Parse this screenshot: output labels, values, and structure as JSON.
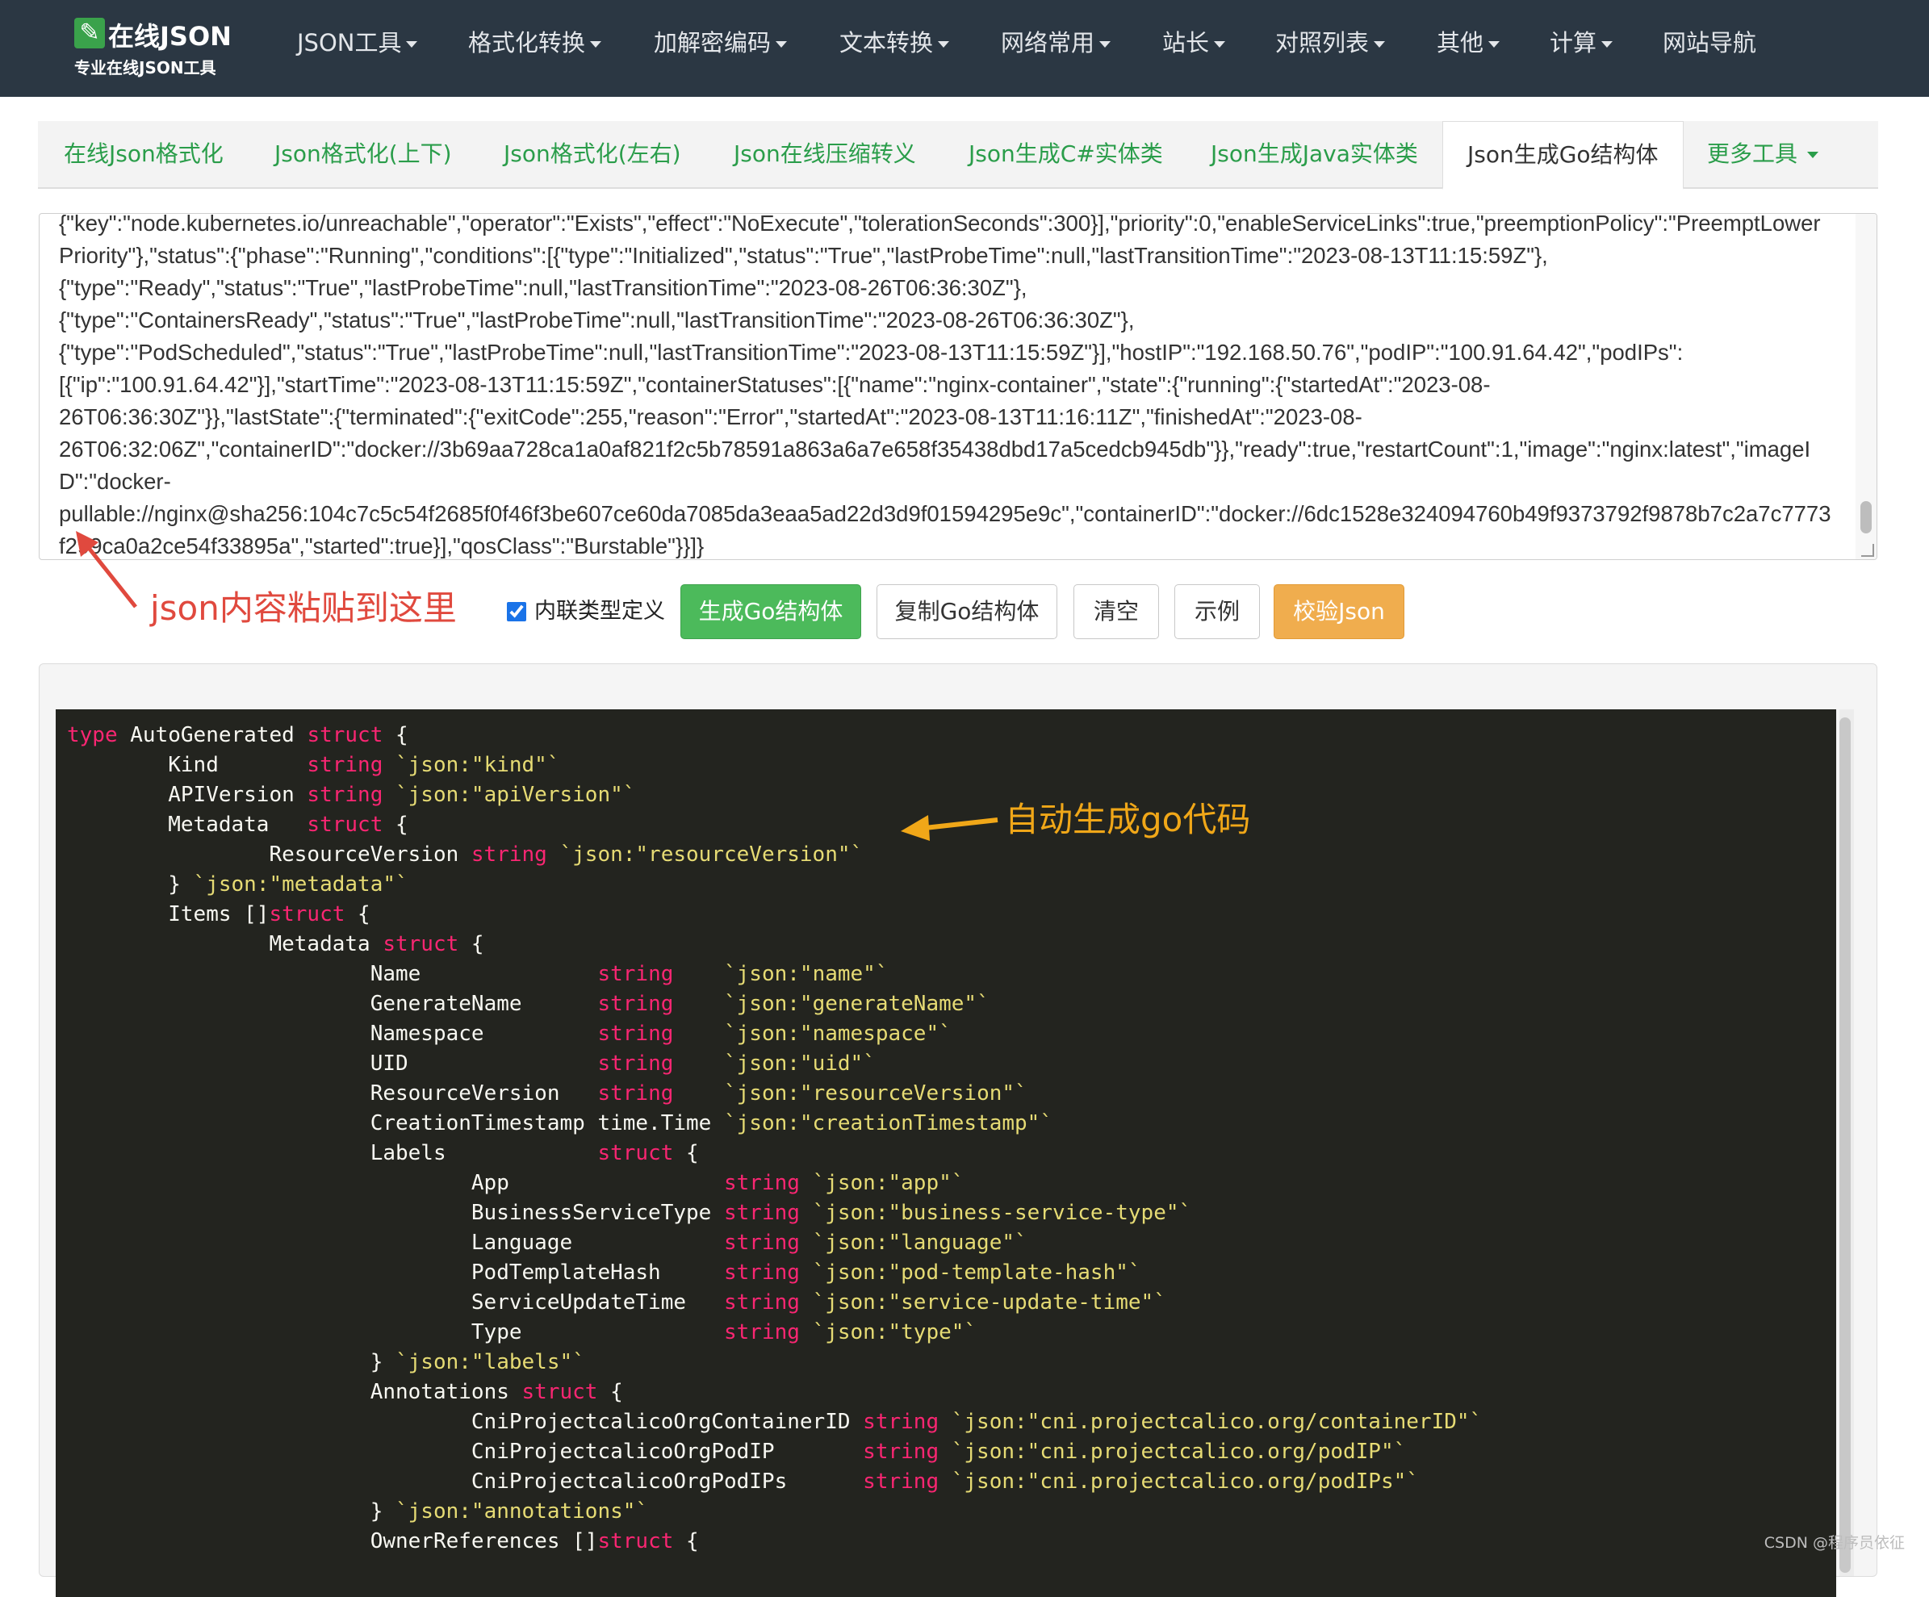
{
  "brand": {
    "title": "在线JSON",
    "subtitle": "专业在线JSON工具",
    "icon": "wrench-icon"
  },
  "nav": [
    {
      "label": "JSON工具",
      "dropdown": true
    },
    {
      "label": "格式化转换",
      "dropdown": true
    },
    {
      "label": "加解密编码",
      "dropdown": true
    },
    {
      "label": "文本转换",
      "dropdown": true
    },
    {
      "label": "网络常用",
      "dropdown": true
    },
    {
      "label": "站长",
      "dropdown": true
    },
    {
      "label": "对照列表",
      "dropdown": true
    },
    {
      "label": "其他",
      "dropdown": true
    },
    {
      "label": "计算",
      "dropdown": true
    },
    {
      "label": "网站导航",
      "dropdown": false
    }
  ],
  "tabs": [
    {
      "label": "在线Json格式化"
    },
    {
      "label": "Json格式化(上下)"
    },
    {
      "label": "Json格式化(左右)"
    },
    {
      "label": "Json在线压缩转义"
    },
    {
      "label": "Json生成C#实体类"
    },
    {
      "label": "Json生成Java实体类"
    },
    {
      "label": "Json生成Go结构体",
      "active": true
    },
    {
      "label": "更多工具",
      "dropdown": true
    }
  ],
  "json_input": {
    "value": "{\"key\":\"node.kubernetes.io/unreachable\",\"operator\":\"Exists\",\"effect\":\"NoExecute\",\"tolerationSeconds\":300}],\"priority\":0,\"enableServiceLinks\":true,\"preemptionPolicy\":\"PreemptLowerPriority\"},\"status\":{\"phase\":\"Running\",\"conditions\":[{\"type\":\"Initialized\",\"status\":\"True\",\"lastProbeTime\":null,\"lastTransitionTime\":\"2023-08-13T11:15:59Z\"},\n{\"type\":\"Ready\",\"status\":\"True\",\"lastProbeTime\":null,\"lastTransitionTime\":\"2023-08-26T06:36:30Z\"},\n{\"type\":\"ContainersReady\",\"status\":\"True\",\"lastProbeTime\":null,\"lastTransitionTime\":\"2023-08-26T06:36:30Z\"},\n{\"type\":\"PodScheduled\",\"status\":\"True\",\"lastProbeTime\":null,\"lastTransitionTime\":\"2023-08-13T11:15:59Z\"}],\"hostIP\":\"192.168.50.76\",\"podIP\":\"100.91.64.42\",\"podIPs\":\n[{\"ip\":\"100.91.64.42\"}],\"startTime\":\"2023-08-13T11:15:59Z\",\"containerStatuses\":[{\"name\":\"nginx-container\",\"state\":{\"running\":{\"startedAt\":\"2023-08-\n26T06:36:30Z\"}},\"lastState\":{\"terminated\":{\"exitCode\":255,\"reason\":\"Error\",\"startedAt\":\"2023-08-13T11:16:11Z\",\"finishedAt\":\"2023-08-\n26T06:32:06Z\",\"containerID\":\"docker://3b69aa728ca1a0af821f2c5b78591a863a6a7e658f35438dbd17a5cedcb945db\"}},\"ready\":true,\"restartCount\":1,\"image\":\"nginx:latest\",\"imageID\":\"docker-\npullable://nginx@sha256:104c7c5c54f2685f0f46f3be607ce60da7085da3eaa5ad22d3d9f01594295e9c\",\"containerID\":\"docker://6dc1528e324094760b49f9373792f9878b7c2a7c7773f299ca0a2ce54f33895a\",\"started\":true}],\"qosClass\":\"Burstable\"}}]}"
  },
  "annotations": {
    "paste_hint": "json内容粘贴到这里",
    "output_hint": "自动生成go代码"
  },
  "controls": {
    "inline_label": "内联类型定义",
    "inline_checked": true,
    "generate": "生成Go结构体",
    "copy": "复制Go结构体",
    "clear": "清空",
    "example": "示例",
    "validate": "校验Json"
  },
  "colors": {
    "keyword": "#f92672",
    "tag": "#e6db74",
    "green_button": "#4cba5b",
    "orange_button": "#f0ad4e",
    "navbar": "#2b3743"
  },
  "output": {
    "lines": [
      [
        [
          "kw",
          "type"
        ],
        [
          "pl",
          " AutoGenerated "
        ],
        [
          "kw",
          "struct"
        ],
        [
          "pl",
          " {"
        ]
      ],
      [
        [
          "pl",
          "\tKind       "
        ],
        [
          "kw",
          "string"
        ],
        [
          "pl",
          " "
        ],
        [
          "tg",
          "`json:\"kind\"`"
        ]
      ],
      [
        [
          "pl",
          "\tAPIVersion "
        ],
        [
          "kw",
          "string"
        ],
        [
          "pl",
          " "
        ],
        [
          "tg",
          "`json:\"apiVersion\"`"
        ]
      ],
      [
        [
          "pl",
          "\tMetadata   "
        ],
        [
          "kw",
          "struct"
        ],
        [
          "pl",
          " {"
        ]
      ],
      [
        [
          "pl",
          "\t\tResourceVersion "
        ],
        [
          "kw",
          "string"
        ],
        [
          "pl",
          " "
        ],
        [
          "tg",
          "`json:\"resourceVersion\"`"
        ]
      ],
      [
        [
          "pl",
          "\t} "
        ],
        [
          "tg",
          "`json:\"metadata\"`"
        ]
      ],
      [
        [
          "pl",
          "\tItems []"
        ],
        [
          "kw",
          "struct"
        ],
        [
          "pl",
          " {"
        ]
      ],
      [
        [
          "pl",
          "\t\tMetadata "
        ],
        [
          "kw",
          "struct"
        ],
        [
          "pl",
          " {"
        ]
      ],
      [
        [
          "pl",
          "\t\t\tName              "
        ],
        [
          "kw",
          "string"
        ],
        [
          "pl",
          "    "
        ],
        [
          "tg",
          "`json:\"name\"`"
        ]
      ],
      [
        [
          "pl",
          "\t\t\tGenerateName      "
        ],
        [
          "kw",
          "string"
        ],
        [
          "pl",
          "    "
        ],
        [
          "tg",
          "`json:\"generateName\"`"
        ]
      ],
      [
        [
          "pl",
          "\t\t\tNamespace         "
        ],
        [
          "kw",
          "string"
        ],
        [
          "pl",
          "    "
        ],
        [
          "tg",
          "`json:\"namespace\"`"
        ]
      ],
      [
        [
          "pl",
          "\t\t\tUID               "
        ],
        [
          "kw",
          "string"
        ],
        [
          "pl",
          "    "
        ],
        [
          "tg",
          "`json:\"uid\"`"
        ]
      ],
      [
        [
          "pl",
          "\t\t\tResourceVersion   "
        ],
        [
          "kw",
          "string"
        ],
        [
          "pl",
          "    "
        ],
        [
          "tg",
          "`json:\"resourceVersion\"`"
        ]
      ],
      [
        [
          "pl",
          "\t\t\tCreationTimestamp time.Time "
        ],
        [
          "tg",
          "`json:\"creationTimestamp\"`"
        ]
      ],
      [
        [
          "pl",
          "\t\t\tLabels            "
        ],
        [
          "kw",
          "struct"
        ],
        [
          "pl",
          " {"
        ]
      ],
      [
        [
          "pl",
          "\t\t\t\tApp                 "
        ],
        [
          "kw",
          "string"
        ],
        [
          "pl",
          " "
        ],
        [
          "tg",
          "`json:\"app\"`"
        ]
      ],
      [
        [
          "pl",
          "\t\t\t\tBusinessServiceType "
        ],
        [
          "kw",
          "string"
        ],
        [
          "pl",
          " "
        ],
        [
          "tg",
          "`json:\"business-service-type\"`"
        ]
      ],
      [
        [
          "pl",
          "\t\t\t\tLanguage            "
        ],
        [
          "kw",
          "string"
        ],
        [
          "pl",
          " "
        ],
        [
          "tg",
          "`json:\"language\"`"
        ]
      ],
      [
        [
          "pl",
          "\t\t\t\tPodTemplateHash     "
        ],
        [
          "kw",
          "string"
        ],
        [
          "pl",
          " "
        ],
        [
          "tg",
          "`json:\"pod-template-hash\"`"
        ]
      ],
      [
        [
          "pl",
          "\t\t\t\tServiceUpdateTime   "
        ],
        [
          "kw",
          "string"
        ],
        [
          "pl",
          " "
        ],
        [
          "tg",
          "`json:\"service-update-time\"`"
        ]
      ],
      [
        [
          "pl",
          "\t\t\t\tType                "
        ],
        [
          "kw",
          "string"
        ],
        [
          "pl",
          " "
        ],
        [
          "tg",
          "`json:\"type\"`"
        ]
      ],
      [
        [
          "pl",
          "\t\t\t} "
        ],
        [
          "tg",
          "`json:\"labels\"`"
        ]
      ],
      [
        [
          "pl",
          "\t\t\tAnnotations "
        ],
        [
          "kw",
          "struct"
        ],
        [
          "pl",
          " {"
        ]
      ],
      [
        [
          "pl",
          "\t\t\t\tCniProjectcalicoOrgContainerID "
        ],
        [
          "kw",
          "string"
        ],
        [
          "pl",
          " "
        ],
        [
          "tg",
          "`json:\"cni.projectcalico.org/containerID\"`"
        ]
      ],
      [
        [
          "pl",
          "\t\t\t\tCniProjectcalicoOrgPodIP       "
        ],
        [
          "kw",
          "string"
        ],
        [
          "pl",
          " "
        ],
        [
          "tg",
          "`json:\"cni.projectcalico.org/podIP\"`"
        ]
      ],
      [
        [
          "pl",
          "\t\t\t\tCniProjectcalicoOrgPodIPs      "
        ],
        [
          "kw",
          "string"
        ],
        [
          "pl",
          " "
        ],
        [
          "tg",
          "`json:\"cni.projectcalico.org/podIPs\"`"
        ]
      ],
      [
        [
          "pl",
          "\t\t\t} "
        ],
        [
          "tg",
          "`json:\"annotations\"`"
        ]
      ],
      [
        [
          "pl",
          "\t\t\tOwnerReferences []"
        ],
        [
          "kw",
          "struct"
        ],
        [
          "pl",
          " {"
        ]
      ]
    ]
  },
  "watermark": "CSDN @程序员依征"
}
